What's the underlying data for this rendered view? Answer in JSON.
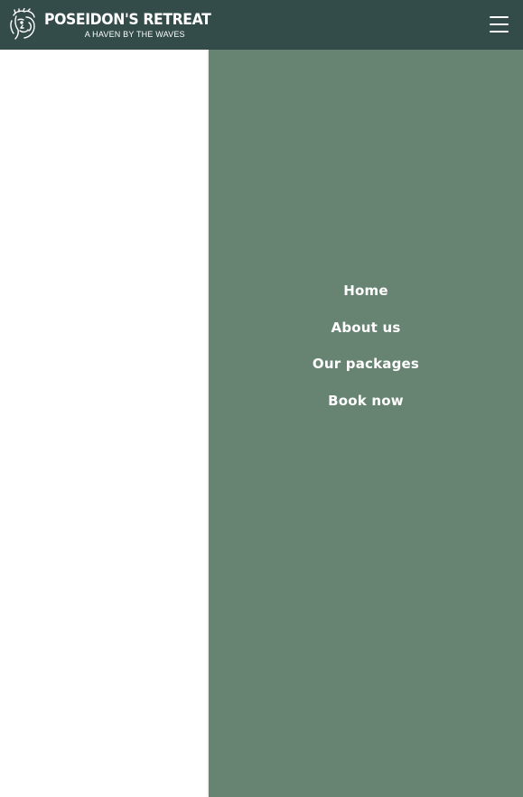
{
  "header": {
    "brand_name": "POSEIDON'S RETREAT",
    "tagline": "A HAVEN BY THE WAVES",
    "logo_icon": "poseidon-head-icon",
    "menu_icon": "hamburger-menu-icon"
  },
  "nav": {
    "items": [
      {
        "label": "Home"
      },
      {
        "label": "About us"
      },
      {
        "label": "Our packages"
      },
      {
        "label": "Book now"
      }
    ]
  },
  "colors": {
    "header_bg": "#334b49",
    "nav_panel_bg": "#678472",
    "text": "#ffffff"
  }
}
